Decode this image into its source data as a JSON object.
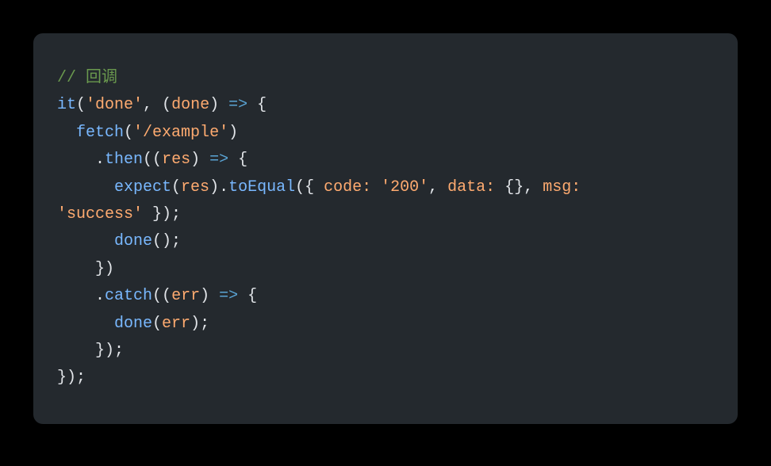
{
  "code": {
    "line1_comment": "// 回调",
    "line2_it": "it",
    "line2_string_done": "'done'",
    "line2_done_param": "done",
    "line3_fetch": "fetch",
    "line3_url": "'/example'",
    "line4_then": "then",
    "line4_res": "res",
    "line5_expect": "expect",
    "line5_res": "res",
    "line5_toEqual": "toEqual",
    "line5_code_label": "code:",
    "line5_code_val": "'200'",
    "line5_data_label": "data:",
    "line5_msg_label": "msg:",
    "line6_success": "'success'",
    "line7_done": "done",
    "line9_catch": "catch",
    "line9_err": "err",
    "line10_done": "done",
    "line10_err": "err"
  }
}
